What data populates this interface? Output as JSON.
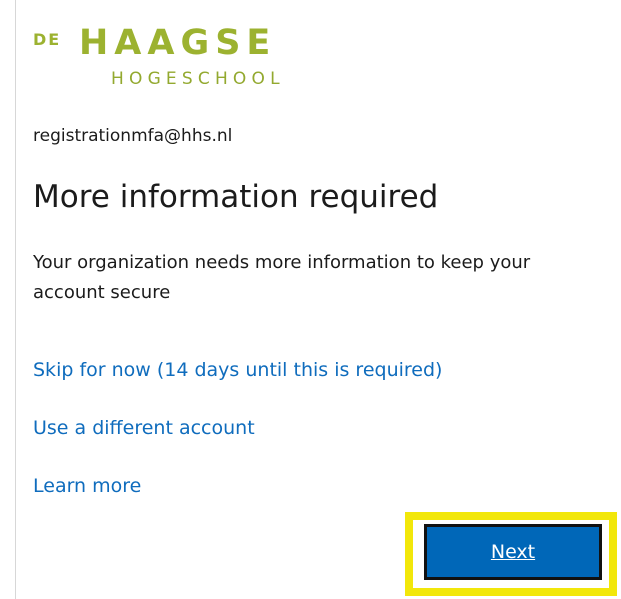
{
  "brand": {
    "logo_de": "DE",
    "logo_main": "HAAGSE",
    "logo_sub": "HOGESCHOOL",
    "logo_color": "#9cb230",
    "logo_sub_color": "#93a92f"
  },
  "account": {
    "email": "registrationmfa@hhs.nl"
  },
  "main": {
    "title": "More information required",
    "description": "Your organization needs more information to keep your account secure"
  },
  "links": {
    "skip": "Skip for now (14 days until this is required)",
    "different_account": "Use a different account",
    "learn_more": "Learn more"
  },
  "actions": {
    "next_label": "Next"
  },
  "colors": {
    "link": "#0f6cbd",
    "button_bg": "#0067b8",
    "highlight": "#f2e70a",
    "text": "#1b1b1b"
  },
  "icons": {
    "logo": "haagse-hogeschool-logo"
  }
}
